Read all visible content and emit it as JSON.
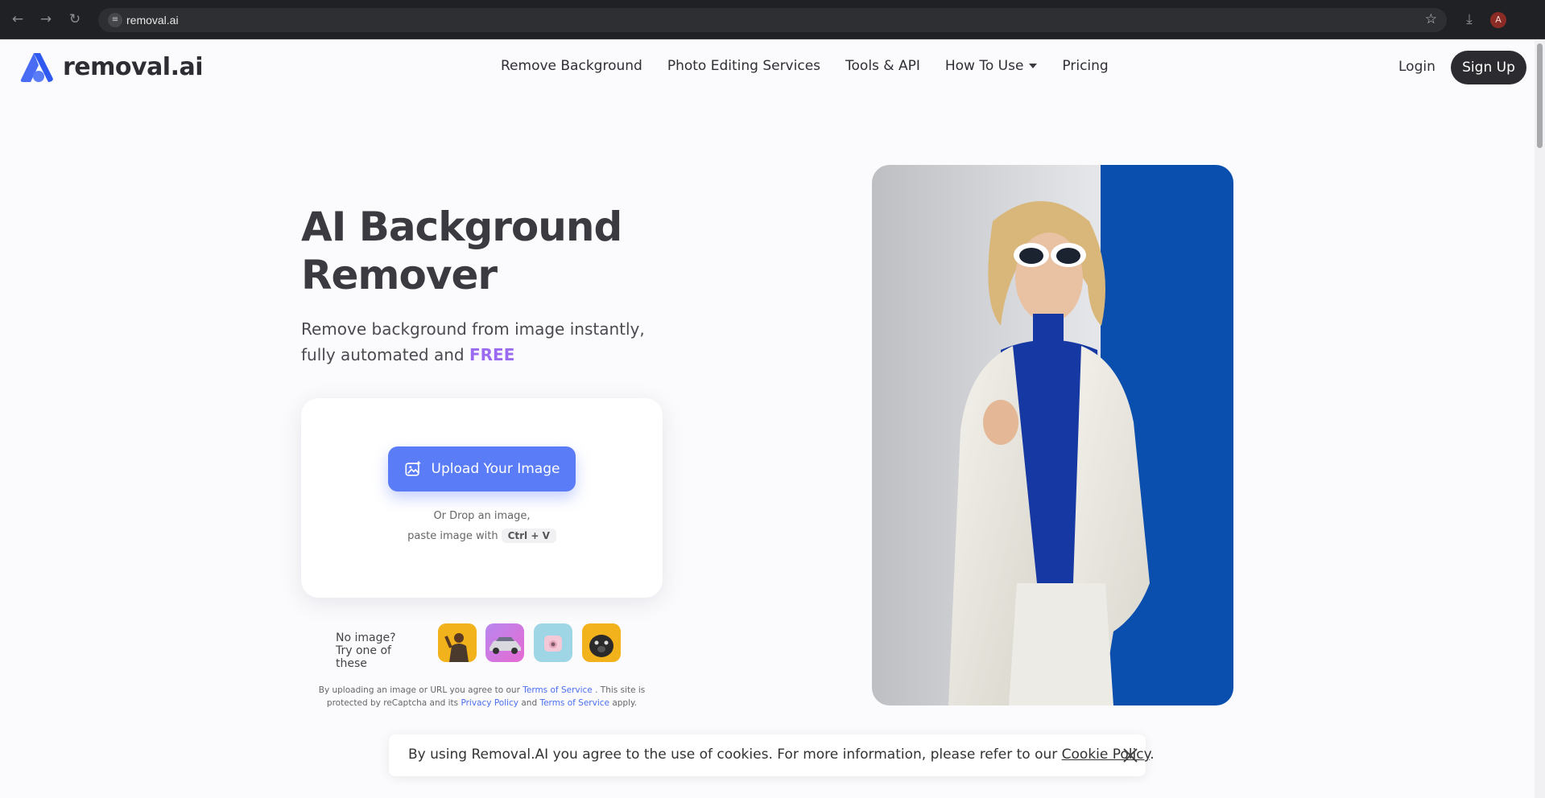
{
  "browser": {
    "back_icon": "back-arrow-icon",
    "forward_icon": "forward-arrow-icon",
    "reload_icon": "reload-icon",
    "url": "removal.ai",
    "site_info_icon": "tune-icon",
    "bookmark_icon": "star-icon",
    "download_icon": "download-icon",
    "profile_initial": "A"
  },
  "header": {
    "logo_text": "removal.ai",
    "nav": [
      {
        "label": "Remove Background"
      },
      {
        "label": "Photo Editing Services"
      },
      {
        "label": "Tools & API"
      },
      {
        "label": "How To Use",
        "has_dropdown": true
      },
      {
        "label": "Pricing"
      }
    ],
    "login_label": "Login",
    "signup_label": "Sign Up"
  },
  "hero": {
    "title_line1": "AI Background",
    "title_line2": "Remover",
    "subtitle_line1": "Remove background from image instantly,",
    "subtitle_line2_prefix": "fully automated and ",
    "subtitle_highlight": "FREE",
    "highlight_color": "#9a6bf0"
  },
  "upload": {
    "button_label": "Upload Your Image",
    "button_color": "#5b7cf7",
    "drop_text": "Or Drop an image,",
    "paste_text": "paste image with",
    "shortcut": "Ctrl + V"
  },
  "samples": {
    "prompt_line1": "No image?",
    "prompt_line2": "Try one of these",
    "items": [
      "sample-person",
      "sample-car",
      "sample-camera",
      "sample-dog"
    ]
  },
  "legal": {
    "part1": "By uploading an image or URL you agree to our ",
    "terms1": "Terms of Service",
    "part2": " . This site is protected by reCaptcha and its ",
    "privacy": "Privacy Policy",
    "part3": " and ",
    "terms2": "Terms of Service",
    "part4": " apply."
  },
  "cookie": {
    "text": "By using Removal.AI you agree to the use of cookies. For more information, please refer to our ",
    "link": "Cookie Policy",
    "suffix": "."
  }
}
